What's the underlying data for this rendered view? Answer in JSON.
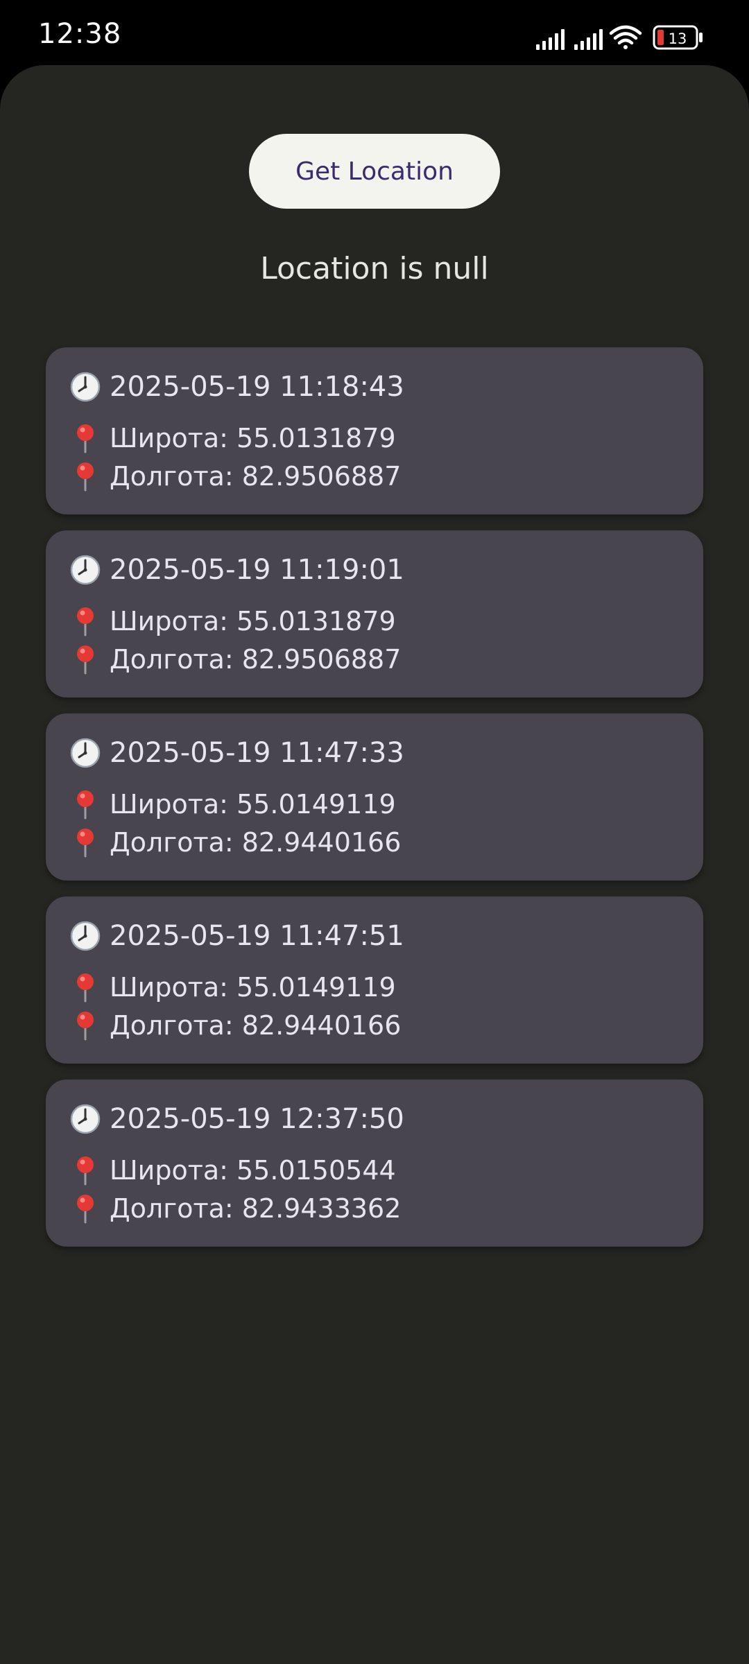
{
  "status_bar": {
    "time": "12:38",
    "battery_level": "13",
    "icons": [
      "cellular-signal-1-icon",
      "cellular-signal-2-icon",
      "wifi-icon",
      "battery-icon"
    ]
  },
  "main": {
    "button_label": "Get Location",
    "status_text": "Location is null",
    "latitude_label": "Широта:",
    "longitude_label": "Долгота:",
    "time_icon": "clock-icon",
    "location_icon": "pin-icon",
    "entries": [
      {
        "timestamp": "2025-05-19 11:18:43",
        "latitude_text": "Широта: 55.0131879",
        "longitude_text": "Долгота: 82.9506887"
      },
      {
        "timestamp": "2025-05-19 11:19:01",
        "latitude_text": "Широта: 55.0131879",
        "longitude_text": "Долгота: 82.9506887"
      },
      {
        "timestamp": "2025-05-19 11:47:33",
        "latitude_text": "Широта: 55.0149119",
        "longitude_text": "Долгота: 82.9440166"
      },
      {
        "timestamp": "2025-05-19 11:47:51",
        "latitude_text": "Широта: 55.0149119",
        "longitude_text": "Долгота: 82.9440166"
      },
      {
        "timestamp": "2025-05-19 12:37:50",
        "latitude_text": "Широта: 55.0150544",
        "longitude_text": "Долгота: 82.9433362"
      }
    ]
  },
  "colors": {
    "background": "#252622",
    "card": "#48454f",
    "button_bg": "#f4f4ee",
    "button_text": "#3a2a6e",
    "pin": "#e53935",
    "battery_low": "#e53935"
  }
}
